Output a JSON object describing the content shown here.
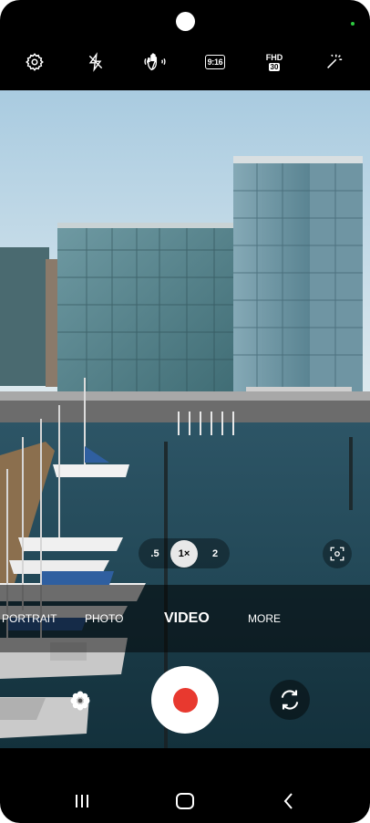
{
  "top_bar": {
    "settings_icon": "gear-icon",
    "flash_icon": "flash-off-icon",
    "stabilization_icon": "shaking-hand-icon",
    "aspect_ratio": "9:16",
    "resolution": "FHD",
    "fps": "30",
    "effects_icon": "magic-wand-icon"
  },
  "zoom": {
    "options": [
      ".5",
      "1×",
      "2"
    ],
    "selected": "1×"
  },
  "focus_icon": "focus-target-icon",
  "modes": [
    "PORTRAIT",
    "PHOTO",
    "VIDEO",
    "MORE"
  ],
  "active_mode": "VIDEO",
  "controls": {
    "left_icon": "flower-icon",
    "shutter_icon": "record-icon",
    "right_icon": "switch-camera-icon"
  },
  "nav": {
    "recents_icon": "recents-icon",
    "home_icon": "home-icon",
    "back_icon": "back-icon"
  },
  "colors": {
    "record_red": "#e8392f",
    "status_green": "#2ecc40"
  }
}
